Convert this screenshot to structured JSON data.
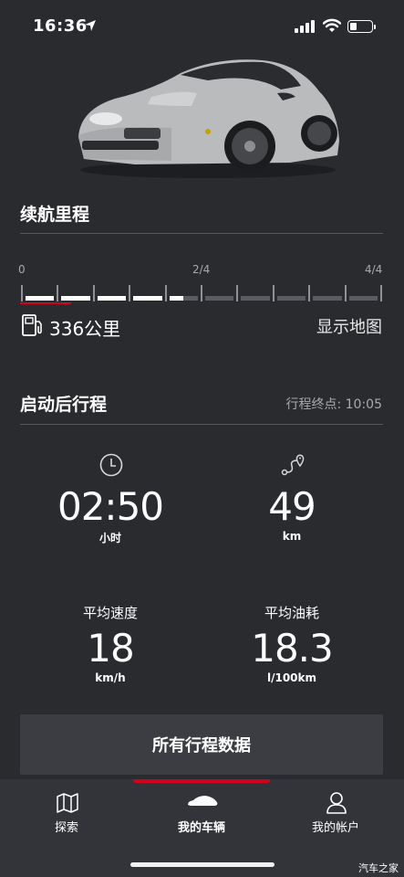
{
  "status_bar": {
    "time": "16:36",
    "battery_level": 0.3
  },
  "range": {
    "title": "续航里程",
    "gauge_labels": [
      "0",
      "2/4",
      "4/4"
    ],
    "fuel_fraction": 0.45,
    "value": "336公里",
    "map_link": "显示地图"
  },
  "trip": {
    "title": "启动后行程",
    "end_time": "行程终点: 10:05",
    "duration": {
      "value": "02:50",
      "unit": "小时"
    },
    "distance": {
      "value": "49",
      "unit": "km"
    },
    "avg_speed": {
      "label": "平均速度",
      "value": "18",
      "unit": "km/h"
    },
    "avg_fuel": {
      "label": "平均油耗",
      "value": "18.3",
      "unit": "l/100km"
    }
  },
  "all_trips_button": "所有行程数据",
  "bottom_nav": [
    {
      "label": "探索",
      "icon": "map-icon"
    },
    {
      "label": "我的车辆",
      "icon": "car-icon",
      "active": true
    },
    {
      "label": "我的帐户",
      "icon": "user-icon"
    }
  ],
  "watermark": "汽车之家",
  "colors": {
    "background": "#2a2b2f",
    "accent": "#d5001c",
    "button": "#3c3d42"
  }
}
